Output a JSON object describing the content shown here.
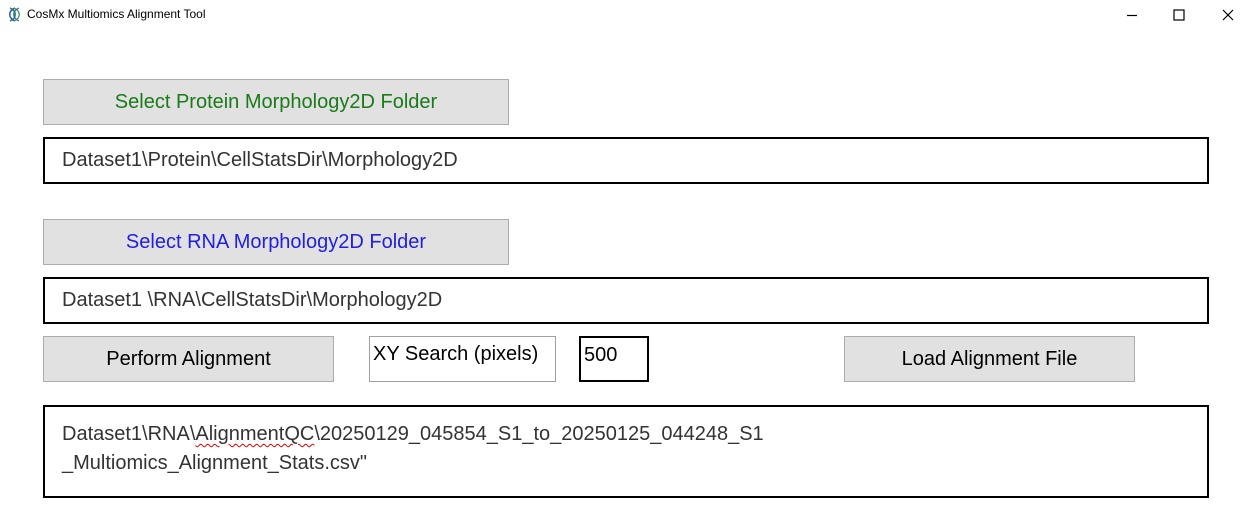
{
  "window": {
    "title": "CosMx Multiomics Alignment Tool",
    "icon": "dna-helix-icon",
    "controls": [
      "minimize-icon",
      "maximize-icon",
      "close-icon"
    ]
  },
  "protein": {
    "button_label": "Select Protein Morphology2D Folder",
    "button_color": "#1a7a1a",
    "path": "Dataset1\\Protein\\CellStatsDir\\Morphology2D"
  },
  "rna": {
    "button_label": "Select RNA Morphology2D Folder",
    "button_color": "#1f1fdd",
    "path": "Dataset1 \\RNA\\CellStatsDir\\Morphology2D"
  },
  "alignment": {
    "perform_label": "Perform Alignment",
    "xy_search_label": "XY Search (pixels)",
    "xy_search_value": "500",
    "load_label": "Load Alignment File"
  },
  "output": {
    "line1_prefix": "Dataset1\\RNA\\",
    "line1_flagged": "AlignmentQC",
    "line1_suffix": "\\20250129_045854_S1_to_20250125_044248_S1",
    "line2": "_Multiomics_Alignment_Stats.csv\""
  }
}
